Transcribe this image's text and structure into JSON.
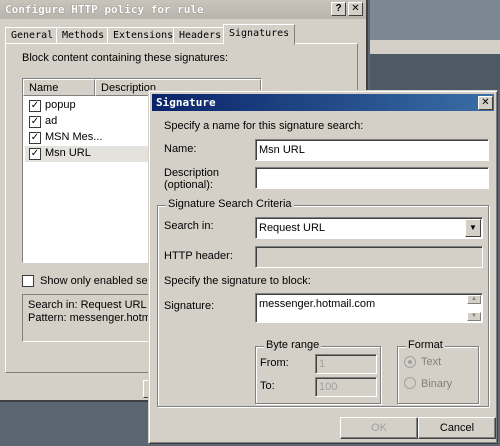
{
  "back_window": {
    "title": "Configure HTTP policy for rule",
    "title_buttons": [
      "?",
      "✕"
    ],
    "tabs": [
      "General",
      "Methods",
      "Extensions",
      "Headers",
      "Signatures"
    ],
    "active_tab": "Signatures",
    "block_label": "Block content containing these signatures:",
    "columns": [
      "Name",
      "Description"
    ],
    "rows": [
      {
        "name": "popup",
        "checked": true
      },
      {
        "name": "ad",
        "checked": true
      },
      {
        "name": "MSN Mes...",
        "checked": true
      },
      {
        "name": "Msn URL",
        "checked": true,
        "selected": true
      }
    ],
    "show_only_label": "Show only enabled searc",
    "info_line1": "Search in: Request URL",
    "info_line2": "Pattern: messenger.hotmai"
  },
  "dialog": {
    "title": "Signature",
    "close_glyph": "✕",
    "intro": "Specify a name for this signature search:",
    "name_label": "Name:",
    "name_value": "Msn URL",
    "description_label_1": "Description",
    "description_label_2": "(optional):",
    "description_value": "",
    "criteria_group": "Signature Search Criteria",
    "search_in_label": "Search in:",
    "search_in_value": "Request URL",
    "http_header_label": "HTTP header:",
    "http_header_value": "",
    "specify_label": "Specify the signature to block:",
    "signature_label": "Signature:",
    "signature_value": "messenger.hotmail.com",
    "byte_range_group": "Byte range",
    "from_label": "From:",
    "from_value": "1",
    "to_label": "To:",
    "to_value": "100",
    "format_group": "Format",
    "format_options": [
      "Text",
      "Binary"
    ],
    "format_selected": "Text",
    "ok_label": "OK",
    "cancel_label": "Cancel"
  },
  "colors": {
    "title_active_start": "#0a246a",
    "title_active_end": "#3a6ea5",
    "window_face": "#d4d0c8",
    "desktop": "#5b6672"
  },
  "icons": [
    "checkbox-checked-icon",
    "dropdown-arrow-icon",
    "spin-up-icon",
    "spin-down-icon",
    "close-icon",
    "help-icon"
  ]
}
